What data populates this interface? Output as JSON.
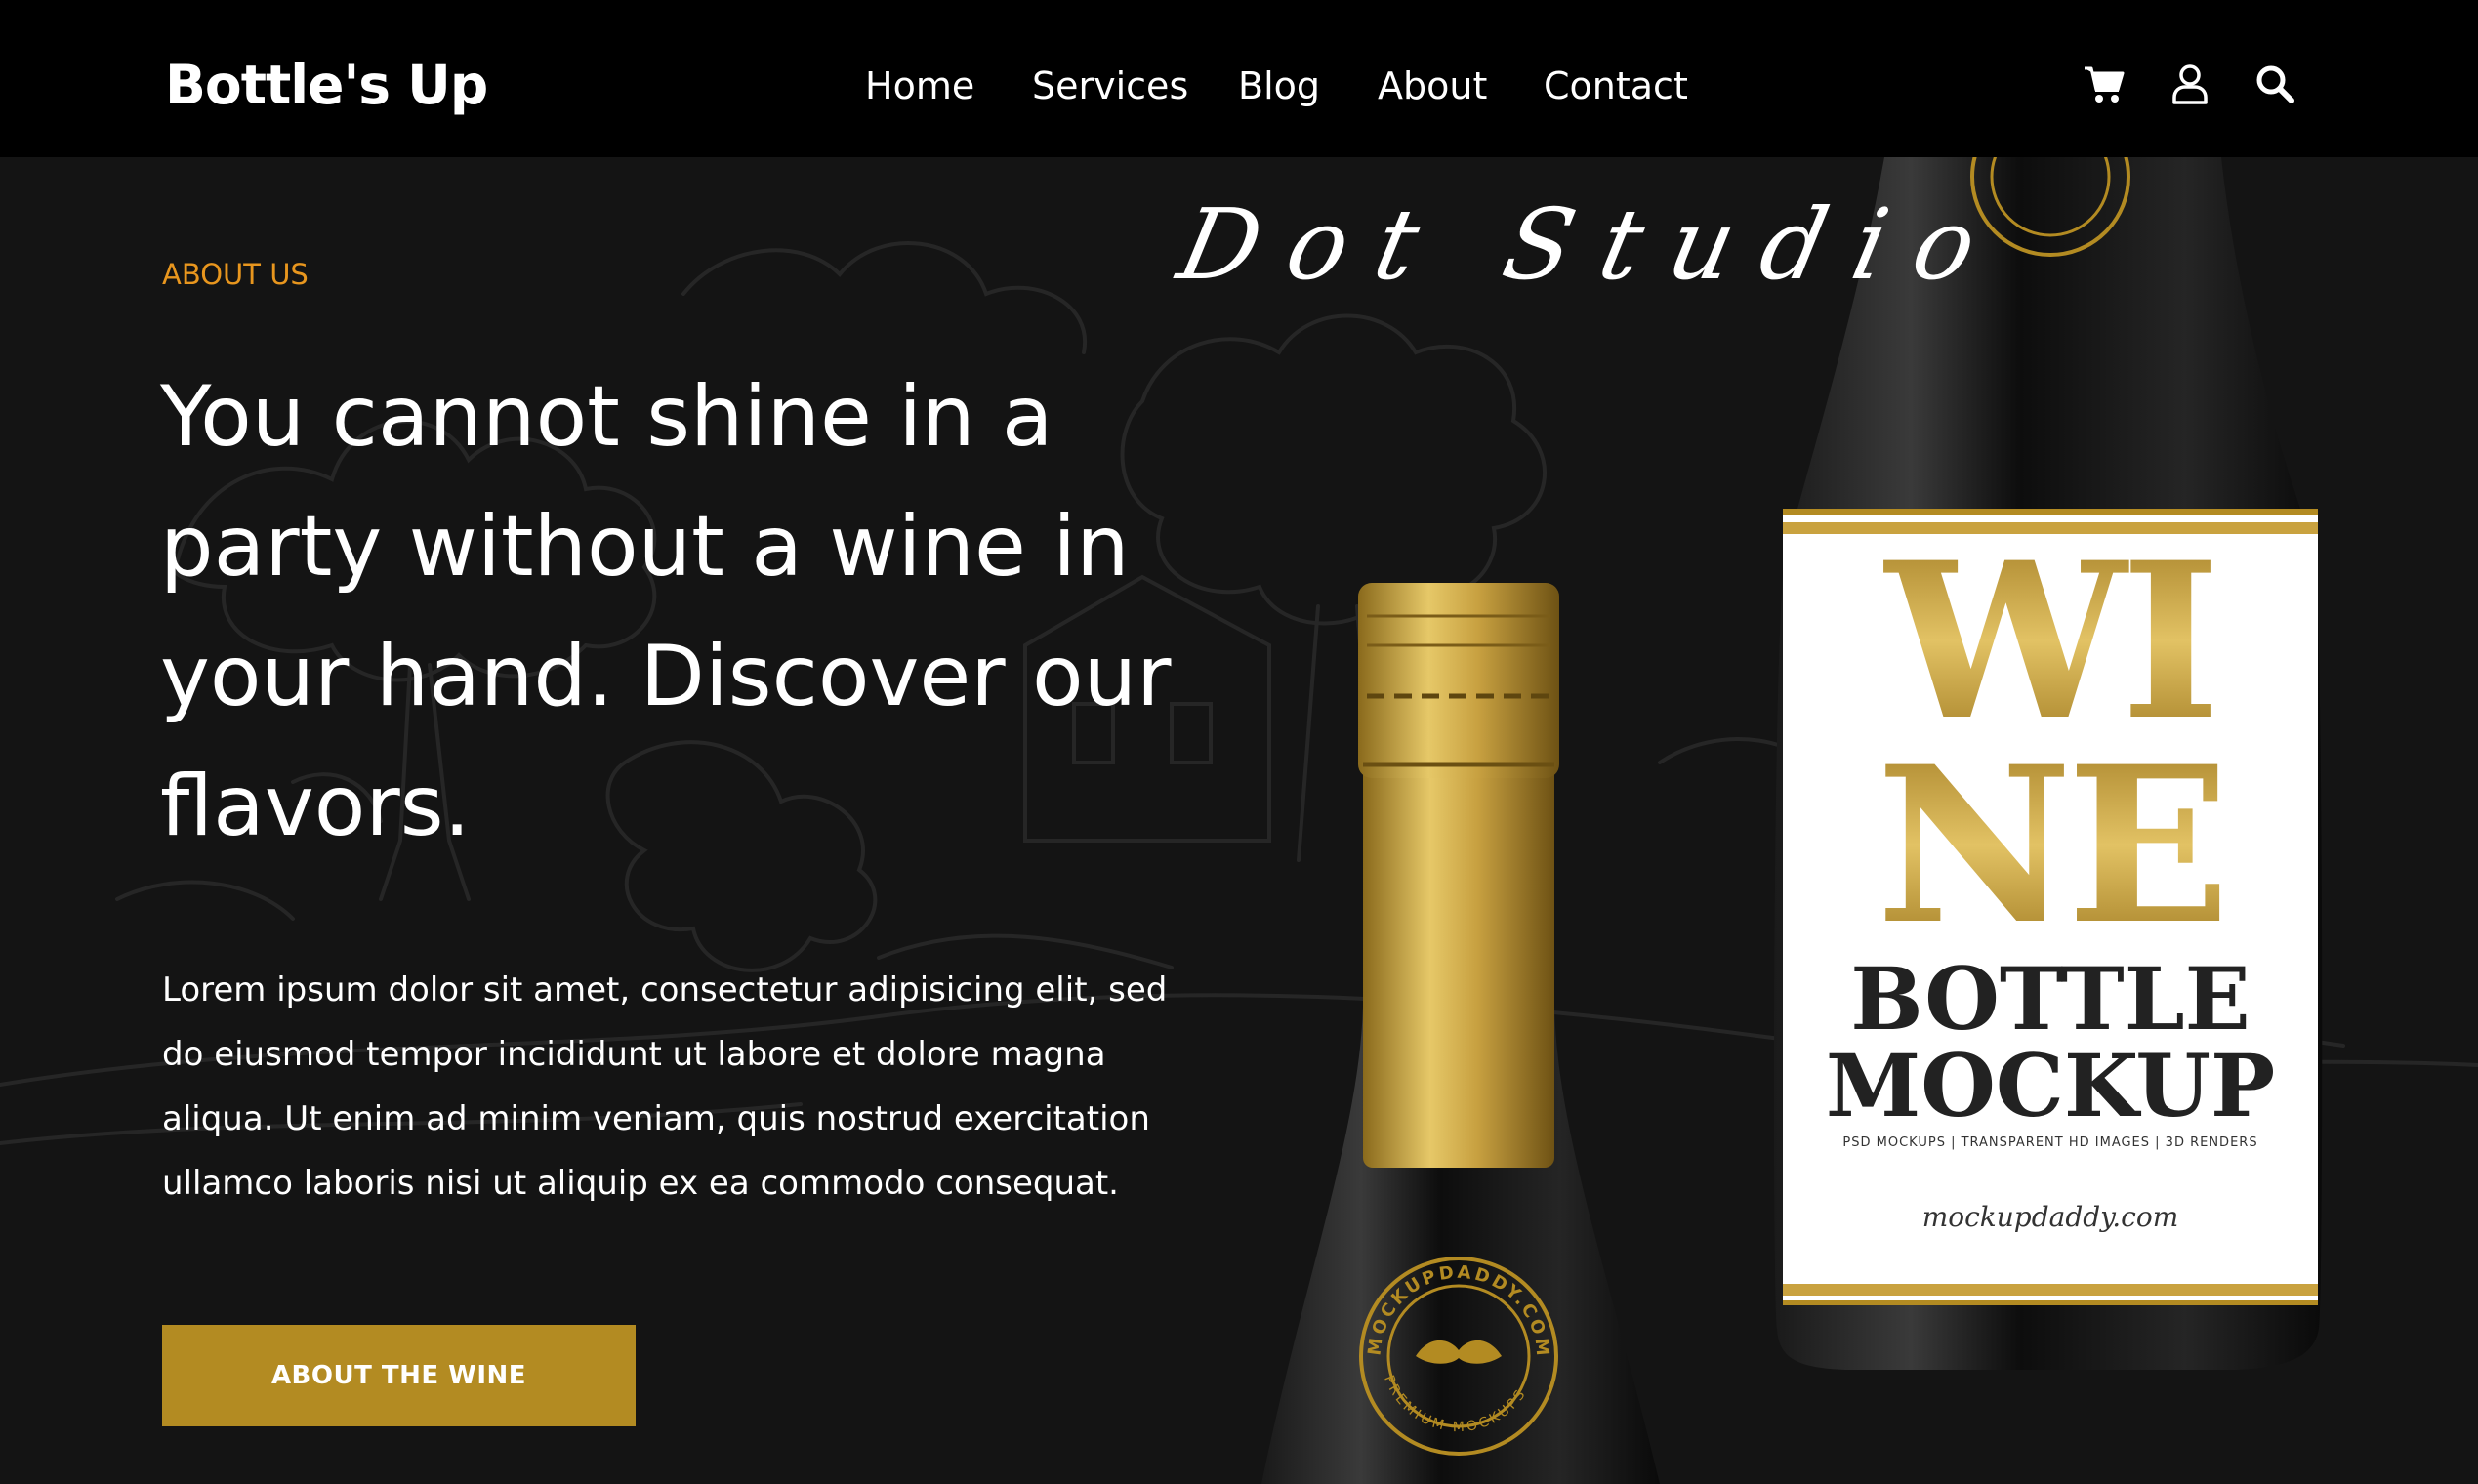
{
  "header": {
    "brand": "Bottle's Up",
    "nav": [
      "Home",
      "Services",
      "Blog",
      "About",
      "Contact"
    ],
    "icons": [
      "cart-icon",
      "user-icon",
      "search-icon"
    ]
  },
  "hero": {
    "eyebrow": "ABOUT US",
    "headline": "You cannot shine in a party without a wine in your hand. Discover our flavors.",
    "body": "Lorem ipsum dolor sit amet, consectetur adipisicing elit, sed do eiusmod tempor incididunt ut labore et dolore magna aliqua. Ut enim ad minim veniam, quis nostrud exercitation ullamco laboris nisi ut aliquip ex ea commodo consequat.",
    "cta": "ABOUT THE WINE",
    "signature": "Dot Studio"
  },
  "label": {
    "line1": "WI",
    "line2": "NE",
    "line3": "BOTTLE",
    "line4": "MOCKUP",
    "tagline": "PSD MOCKUPS | TRANSPARENT HD IMAGES | 3D RENDERS",
    "site": "mockupdaddy.com",
    "seal_top": "MOCKUPDADDY.COM",
    "seal_bottom": "PREMIUM MOCKUPS"
  },
  "colors": {
    "header_bg": "#000000",
    "hero_bg": "#141414",
    "accent_orange": "#e8961e",
    "button_gold": "#b38b22",
    "text": "#ffffff"
  }
}
